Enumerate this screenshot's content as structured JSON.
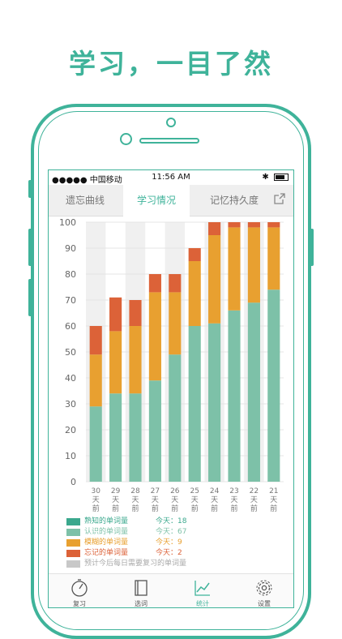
{
  "headline": "学习，一目了然",
  "status_bar": {
    "carrier": "●●●●● 中国移动",
    "time": "11:56 AM",
    "bluetooth": "✱"
  },
  "tabs": [
    {
      "label": "遗忘曲线",
      "active": false
    },
    {
      "label": "学习情况",
      "active": true
    },
    {
      "label": "记忆持久度",
      "active": false
    }
  ],
  "share_icon": "share-icon",
  "colors": {
    "accent": "#3fb39a",
    "known": "#3aa88d",
    "recognized": "#7dc1a8",
    "fuzzy": "#e8a030",
    "forgotten": "#dc6238",
    "projected": "#c8c8c8"
  },
  "chart_data": {
    "type": "bar",
    "stacked": true,
    "categories": [
      "30\n天\n前",
      "29\n天\n前",
      "28\n天\n前",
      "27\n天\n前",
      "26\n天\n前",
      "25\n天\n前",
      "24\n天\n前",
      "23\n天\n前",
      "22\n天\n前",
      "21\n天\n前"
    ],
    "ylim": [
      0,
      100
    ],
    "yticks": [
      0,
      10,
      20,
      30,
      40,
      50,
      60,
      70,
      80,
      90,
      100
    ],
    "grid": true,
    "series": [
      {
        "name": "认识的单词量",
        "color": "#7dc1a8",
        "values": [
          29,
          34,
          34,
          39,
          49,
          60,
          61,
          66,
          69,
          74
        ]
      },
      {
        "name": "模糊的单词量",
        "color": "#e8a030",
        "values": [
          20,
          24,
          26,
          34,
          24,
          25,
          34,
          32,
          29,
          24
        ]
      },
      {
        "name": "忘记的单词量",
        "color": "#dc6238",
        "values": [
          11,
          13,
          10,
          7,
          7,
          5,
          5,
          2,
          2,
          2
        ]
      }
    ],
    "background_columns": [
      {
        "category": "30\n天\n前",
        "value": 100
      },
      {
        "category": "28\n天\n前",
        "value": 100
      },
      {
        "category": "26\n天\n前",
        "value": 100
      },
      {
        "category": "24\n天\n前",
        "value": 100
      },
      {
        "category": "22\n天\n前",
        "value": 100
      }
    ]
  },
  "legend": [
    {
      "name": "熟知的单词量",
      "today": "今天：18",
      "color": "#3aa88d"
    },
    {
      "name": "认识的单词量",
      "today": "今天：67",
      "color": "#7dc1a8"
    },
    {
      "name": "模糊的单词量",
      "today": "今天：9",
      "color": "#e8a030"
    },
    {
      "name": "忘记的单词量",
      "today": "今天：2",
      "color": "#dc6238"
    },
    {
      "name": "预计今后每日需要复习的单词量",
      "today": "",
      "color": "#c8c8c8"
    }
  ],
  "bottom_nav": [
    {
      "label": "复习",
      "icon": "timer-icon",
      "active": false
    },
    {
      "label": "选词",
      "icon": "book-icon",
      "active": false
    },
    {
      "label": "统计",
      "icon": "line-chart-icon",
      "active": true
    },
    {
      "label": "设置",
      "icon": "gear-icon",
      "active": false
    }
  ]
}
